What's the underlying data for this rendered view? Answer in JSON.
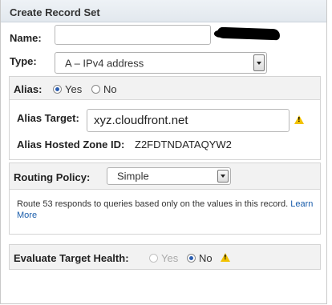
{
  "header": {
    "title": "Create Record Set"
  },
  "form": {
    "name_label": "Name:",
    "name_value": "",
    "type_label": "Type:",
    "type_value": "A – IPv4 address"
  },
  "alias": {
    "label": "Alias:",
    "yes_label": "Yes",
    "no_label": "No",
    "selected": "Yes",
    "target_label": "Alias Target:",
    "target_value": "xyz.cloudfront.net",
    "zone_label": "Alias Hosted Zone ID:",
    "zone_value": "Z2FDTNDATAQYW2"
  },
  "routing": {
    "label": "Routing Policy:",
    "value": "Simple",
    "description": "Route 53 responds to queries based only on the values in this record.",
    "learn_more": "Learn More"
  },
  "health": {
    "label": "Evaluate Target Health:",
    "yes_label": "Yes",
    "no_label": "No",
    "selected": "No",
    "yes_disabled": true
  },
  "colors": {
    "header_bg": "#e6ecf2",
    "section_head_bg": "#f2f2f2",
    "link": "#1a5dab",
    "radio_selected": "#2a5db0",
    "warning": "#f2c200"
  },
  "icons": [
    "warning-icon",
    "chevron-down-icon"
  ]
}
